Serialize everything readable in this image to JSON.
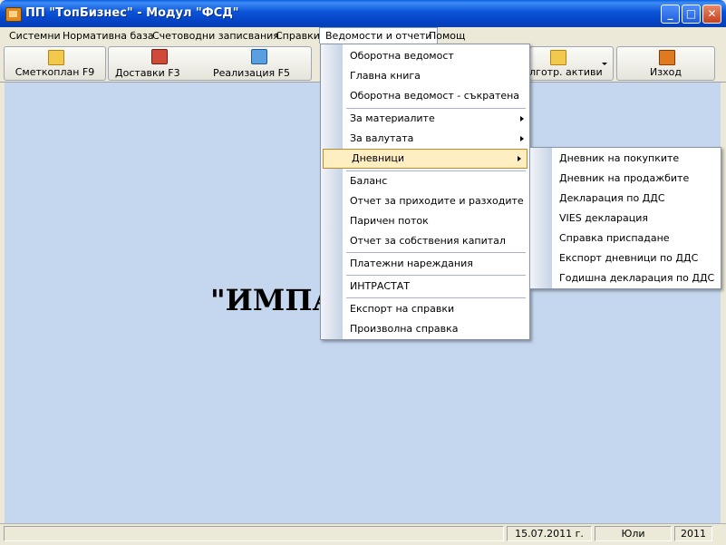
{
  "window": {
    "title": "ПП \"ТопБизнес\" - Модул \"ФСД\"",
    "minimize_glyph": "_",
    "maximize_glyph": "□",
    "close_glyph": "✕"
  },
  "menubar": {
    "items": [
      "Системни",
      "Нормативна база",
      "Счетоводни записвания",
      "Справки",
      "Ведомости и отчети",
      "Помощ"
    ]
  },
  "toolbar": {
    "buttons": [
      {
        "label": "Сметкоплан F9",
        "icon": "folder-icon"
      },
      {
        "label": "Доставки F3",
        "icon": "delivery-icon"
      },
      {
        "label": "Реализация F5",
        "icon": "sales-icon"
      },
      {
        "label": "ълготр. активи",
        "icon": "folder-icon"
      },
      {
        "label": "Изход",
        "icon": "exit-icon"
      }
    ]
  },
  "main": {
    "big_text": "\"ИМПА"
  },
  "dropdown": {
    "items": [
      {
        "label": "Оборотна ведомост"
      },
      {
        "label": "Главна книга"
      },
      {
        "label": "Оборотна ведомост - съкратена"
      },
      {
        "label": "За материалите"
      },
      {
        "label": "За валутата"
      },
      {
        "label": "Дневници"
      },
      {
        "label": "Баланс"
      },
      {
        "label": "Отчет за приходите и разходите"
      },
      {
        "label": "Паричен поток"
      },
      {
        "label": "Отчет за собствения капитал"
      },
      {
        "label": "Платежни нареждания"
      },
      {
        "label": "ИНТРАСТАТ"
      },
      {
        "label": "Експорт на справки"
      },
      {
        "label": "Произволна справка"
      }
    ]
  },
  "submenu": {
    "items": [
      {
        "label": "Дневник на покупките"
      },
      {
        "label": "Дневник на продажбите"
      },
      {
        "label": "Декларация по ДДС"
      },
      {
        "label": "VIES декларация"
      },
      {
        "label": "Справка приспадане"
      },
      {
        "label": "Експорт дневници по ДДС"
      },
      {
        "label": "Годишна декларация по ДДС"
      }
    ]
  },
  "statusbar": {
    "date": "15.07.2011 г.",
    "month": "Юли",
    "year": "2011"
  },
  "colors": {
    "client_bg": "#c5d7ee",
    "highlight": "#ffeec2",
    "titlebar": "#0a53d8"
  }
}
